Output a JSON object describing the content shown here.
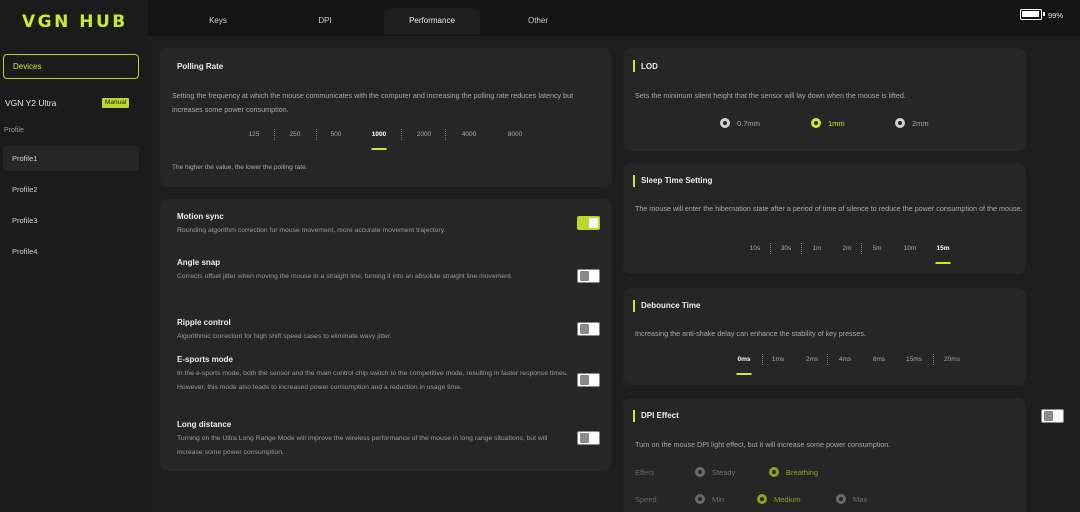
{
  "app": {
    "logo": "VGN HUB"
  },
  "battery": {
    "percent_text": "99%",
    "level": 0.99
  },
  "sidebar": {
    "devices_label": "Devices",
    "device_name": "VGN Y2 Ultra",
    "mode_badge": "Manual",
    "profile_label": "Profile",
    "profiles": [
      "Profile1",
      "Profile2",
      "Profile3",
      "Profile4"
    ],
    "active_profile": "Profile1"
  },
  "tabs": [
    "Keys",
    "DPI",
    "Performance",
    "Other"
  ],
  "active_tab": "Performance",
  "polling_rate": {
    "title": "Polling Rate",
    "description": "Setting the frequency at which the mouse communicates with the computer and increasing the polling rate reduces latency but increases some power consumption.",
    "options": [
      "125",
      "250",
      "500",
      "1000",
      "2000",
      "4000",
      "8000"
    ],
    "selected": "1000",
    "note": "The higher the value, the lower the polling rate."
  },
  "toggles": {
    "motion_sync": {
      "title": "Motion sync",
      "description": "Rounding algorithm correction for mouse movement, more accurate movement trajectory.",
      "on": true
    },
    "angle_snap": {
      "title": "Angle snap",
      "description": "Corrects offset jitter when moving the mouse in a straight line, turning it into an absolute straight line movement.",
      "on": false
    },
    "ripple_control": {
      "title": "Ripple control",
      "description": "Algorithmic correction for high shift speed cases to eliminate wavy jitter.",
      "on": false
    },
    "esports_mode": {
      "title": "E-sports mode",
      "description": "In the e-sports mode, both the sensor and the main control chip switch to the competitive mode, resulting in faster response times. However, this mode also leads to increased power consumption and a reduction in usage time.",
      "on": false
    },
    "long_distance": {
      "title": "Long distance",
      "description": "Turning on the Ultra Long Range Mode will improve the wireless performance of the mouse in long range situations, but will increase some power consumption.",
      "on": false
    }
  },
  "lod": {
    "title": "LOD",
    "description": "Sets the minimum silent height that the sensor will lay down when the mouse is lifted.",
    "options": [
      "0.7mm",
      "1mm",
      "2mm"
    ],
    "selected": "1mm"
  },
  "sleep_time": {
    "title": "Sleep Time Setting",
    "description": "The mouse will enter the hibernation state after a period of time of silence to reduce the power consumption of the mouse.",
    "options": [
      "10s",
      "30s",
      "1m",
      "2m",
      "5m",
      "10m",
      "15m"
    ],
    "selected": "15m"
  },
  "debounce": {
    "title": "Debounce Time",
    "description": "Increasing the anti-shake delay can enhance the stability of key presses.",
    "options": [
      "0ms",
      "1ms",
      "2ms",
      "4ms",
      "8ms",
      "15ms",
      "20ms"
    ],
    "selected": "0ms"
  },
  "dpi_effect": {
    "title": "DPI Effect",
    "description": "Turn on the mouse DPI light effect, but it will increase some power consumption.",
    "on": false,
    "effect_label": "Effect",
    "effect_options": [
      "Steady",
      "Breathing"
    ],
    "effect_selected": "Breathing",
    "speed_label": "Speed",
    "speed_options": [
      "Min",
      "Medium",
      "Max"
    ],
    "speed_selected": "Medium"
  },
  "colors": {
    "accent": "#c6ea2c",
    "background": "#141414",
    "card": "#262626"
  }
}
